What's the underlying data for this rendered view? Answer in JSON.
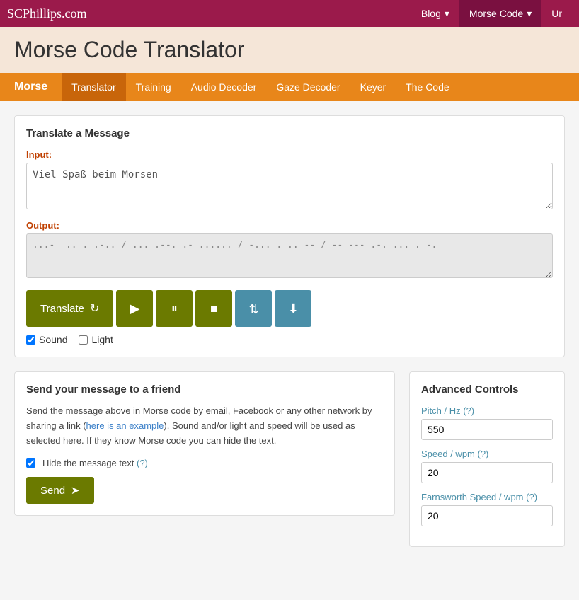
{
  "site": {
    "logo": "SCPhillips.com",
    "title": "Morse Code Translator"
  },
  "topnav": {
    "items": [
      {
        "label": "Blog",
        "active": false,
        "hasDropdown": true
      },
      {
        "label": "Morse Code",
        "active": true,
        "hasDropdown": true
      },
      {
        "label": "Ur",
        "active": false,
        "hasDropdown": false
      }
    ]
  },
  "subnav": {
    "brand": "Morse",
    "items": [
      {
        "label": "Translator",
        "active": true
      },
      {
        "label": "Training",
        "active": false
      },
      {
        "label": "Audio Decoder",
        "active": false
      },
      {
        "label": "Gaze Decoder",
        "active": false
      },
      {
        "label": "Keyer",
        "active": false
      },
      {
        "label": "The Code",
        "active": false
      }
    ]
  },
  "translate_card": {
    "title": "Translate a Message",
    "input_label": "Input:",
    "input_value": "Viel Spaß beim Morsen",
    "output_label": "Output:",
    "output_value": "...-  .. . .-.. / ... .--. .- ...... / -... . .. -- / -- --- .-. ... . -.",
    "buttons": {
      "translate": "Translate",
      "play": "▶",
      "pause": "⏸",
      "stop": "■",
      "share": "⇅",
      "download": "⬇"
    },
    "sound_label": "Sound",
    "light_label": "Light",
    "sound_checked": true,
    "light_checked": false
  },
  "send_card": {
    "title": "Send your message to a friend",
    "description": "Send the message above in Morse code by email, Facebook or any other network by sharing a link (here is an example). Sound and/or light and speed will be used as selected here. If they know Morse code you can hide the text.",
    "link_text": "here is an example",
    "hide_label": "Hide the message text",
    "hide_checked": true,
    "hide_hint": "(?)",
    "send_label": "Send"
  },
  "advanced_controls": {
    "title": "Advanced Controls",
    "pitch_label": "Pitch / Hz",
    "pitch_hint": "(?)",
    "pitch_value": "550",
    "speed_label": "Speed / wpm",
    "speed_hint": "(?)",
    "speed_value": "20",
    "farnsworth_label": "Farnsworth Speed / wpm",
    "farnsworth_hint": "(?)",
    "farnsworth_value": "20"
  }
}
